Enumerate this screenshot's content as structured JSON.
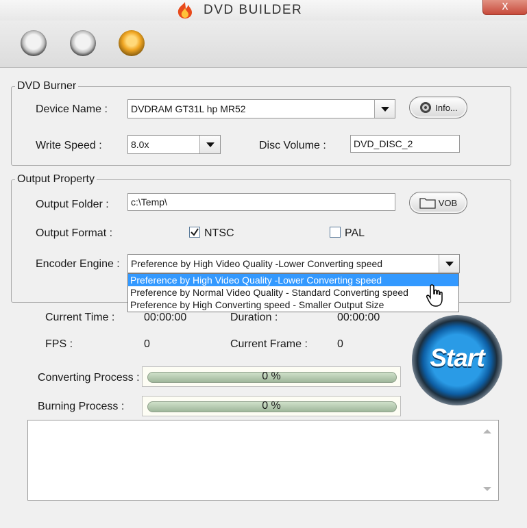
{
  "title": "DVD BUILDER",
  "close_label": "x",
  "dvd_burner": {
    "legend": "DVD Burner",
    "device_label": "Device Name :",
    "device_value": "DVDRAM GT31L     hp       MR52",
    "info_button": "Info...",
    "speed_label": "Write Speed :",
    "speed_value": "8.0x",
    "volume_label": "Disc Volume :",
    "volume_value": "DVD_DISC_2"
  },
  "output_property": {
    "legend": "Output Property",
    "folder_label": "Output Folder :",
    "folder_value": "c:\\Temp\\",
    "vob_button": "VOB",
    "format_label": "Output Format :",
    "ntsc_label": "NTSC",
    "ntsc_checked": true,
    "pal_label": "PAL",
    "pal_checked": false,
    "encoder_label": "Encoder Engine :",
    "encoder_value": "Preference by High Video Quality -Lower Converting speed",
    "encoder_options": [
      "Preference by High Video Quality -Lower Converting speed",
      "Preference by Normal Video Quality - Standard Converting speed",
      "Preference by High Converting speed - Smaller Output Size"
    ],
    "encoder_selected_index": 0
  },
  "status": {
    "current_time_label": "Current Time :",
    "current_time_value": "00:00:00",
    "duration_label": "Duration :",
    "duration_value": "00:00:00",
    "fps_label": "FPS :",
    "fps_value": "0",
    "current_frame_label": "Current Frame :",
    "current_frame_value": "0"
  },
  "progress": {
    "converting_label": "Converting Process :",
    "converting_value": "0 %",
    "converting_fraction": 0,
    "burning_label": "Burning Process :",
    "burning_value": "0 %",
    "burning_fraction": 0
  },
  "start_button": "Start",
  "colors": {
    "accent_orange": "#f0a623",
    "start_blue": "#1b8ad6",
    "selection_blue": "#3399ff"
  },
  "icons": {
    "title": "flame-icon",
    "info": "disc-icon",
    "vob": "folder-icon",
    "pointer": "hand-pointer-icon"
  }
}
